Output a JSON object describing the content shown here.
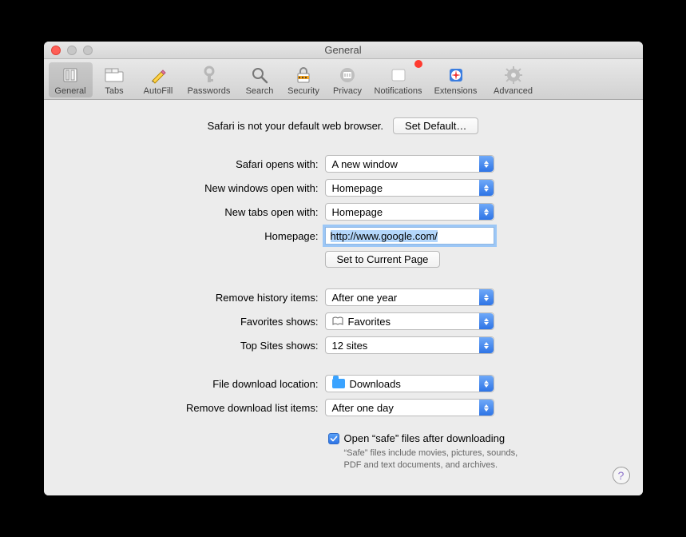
{
  "window": {
    "title": "General"
  },
  "toolbar": {
    "items": [
      {
        "label": "General"
      },
      {
        "label": "Tabs"
      },
      {
        "label": "AutoFill"
      },
      {
        "label": "Passwords"
      },
      {
        "label": "Search"
      },
      {
        "label": "Security"
      },
      {
        "label": "Privacy"
      },
      {
        "label": "Notifications"
      },
      {
        "label": "Extensions"
      },
      {
        "label": "Advanced"
      }
    ]
  },
  "default_browser": {
    "message": "Safari is not your default web browser.",
    "button": "Set Default…"
  },
  "labels": {
    "opens_with": "Safari opens with:",
    "new_windows": "New windows open with:",
    "new_tabs": "New tabs open with:",
    "homepage": "Homepage:",
    "set_current": "Set to Current Page",
    "remove_history": "Remove history items:",
    "favorites": "Favorites shows:",
    "topsites": "Top Sites shows:",
    "download_loc": "File download location:",
    "remove_downloads": "Remove download list items:"
  },
  "values": {
    "opens_with": "A new window",
    "new_windows": "Homepage",
    "new_tabs": "Homepage",
    "homepage": "http://www.google.com/",
    "remove_history": "After one year",
    "favorites": "Favorites",
    "topsites": "12 sites",
    "download_loc": "Downloads",
    "remove_downloads": "After one day"
  },
  "safe_files": {
    "label": "Open “safe” files after downloading",
    "desc": "“Safe” files include movies, pictures, sounds, PDF and text documents, and archives."
  },
  "help": "?"
}
